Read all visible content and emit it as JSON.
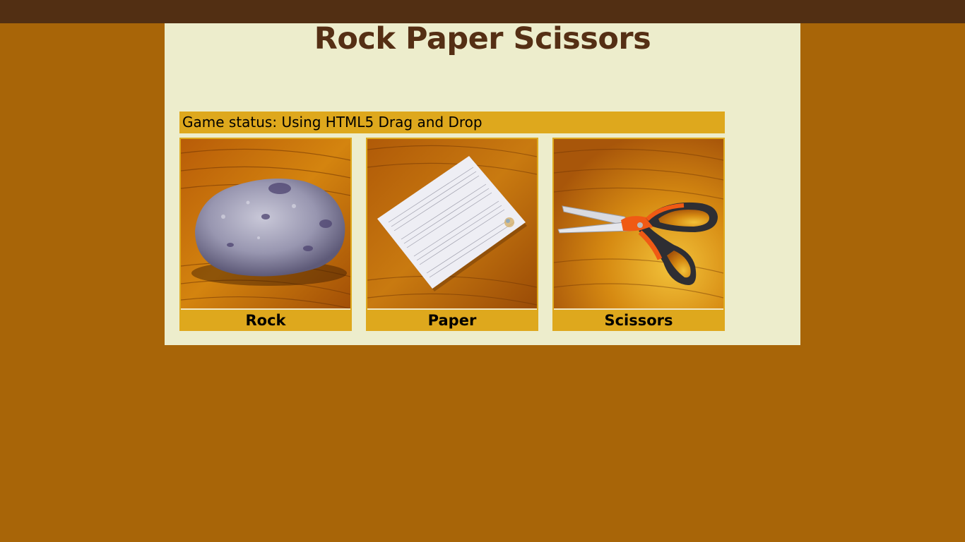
{
  "header": {
    "title": "Rock Paper Scissors"
  },
  "status": {
    "text": "Game status: Using HTML5 Drag and Drop"
  },
  "choices": [
    {
      "label": "Rock",
      "icon": "rock-photo"
    },
    {
      "label": "Paper",
      "icon": "paper-photo"
    },
    {
      "label": "Scissors",
      "icon": "scissors-photo"
    }
  ],
  "colors": {
    "page_background": "#a86508",
    "top_bar": "#522f13",
    "panel": "#ededcc",
    "accent": "#dea81d",
    "title": "#552f14"
  }
}
